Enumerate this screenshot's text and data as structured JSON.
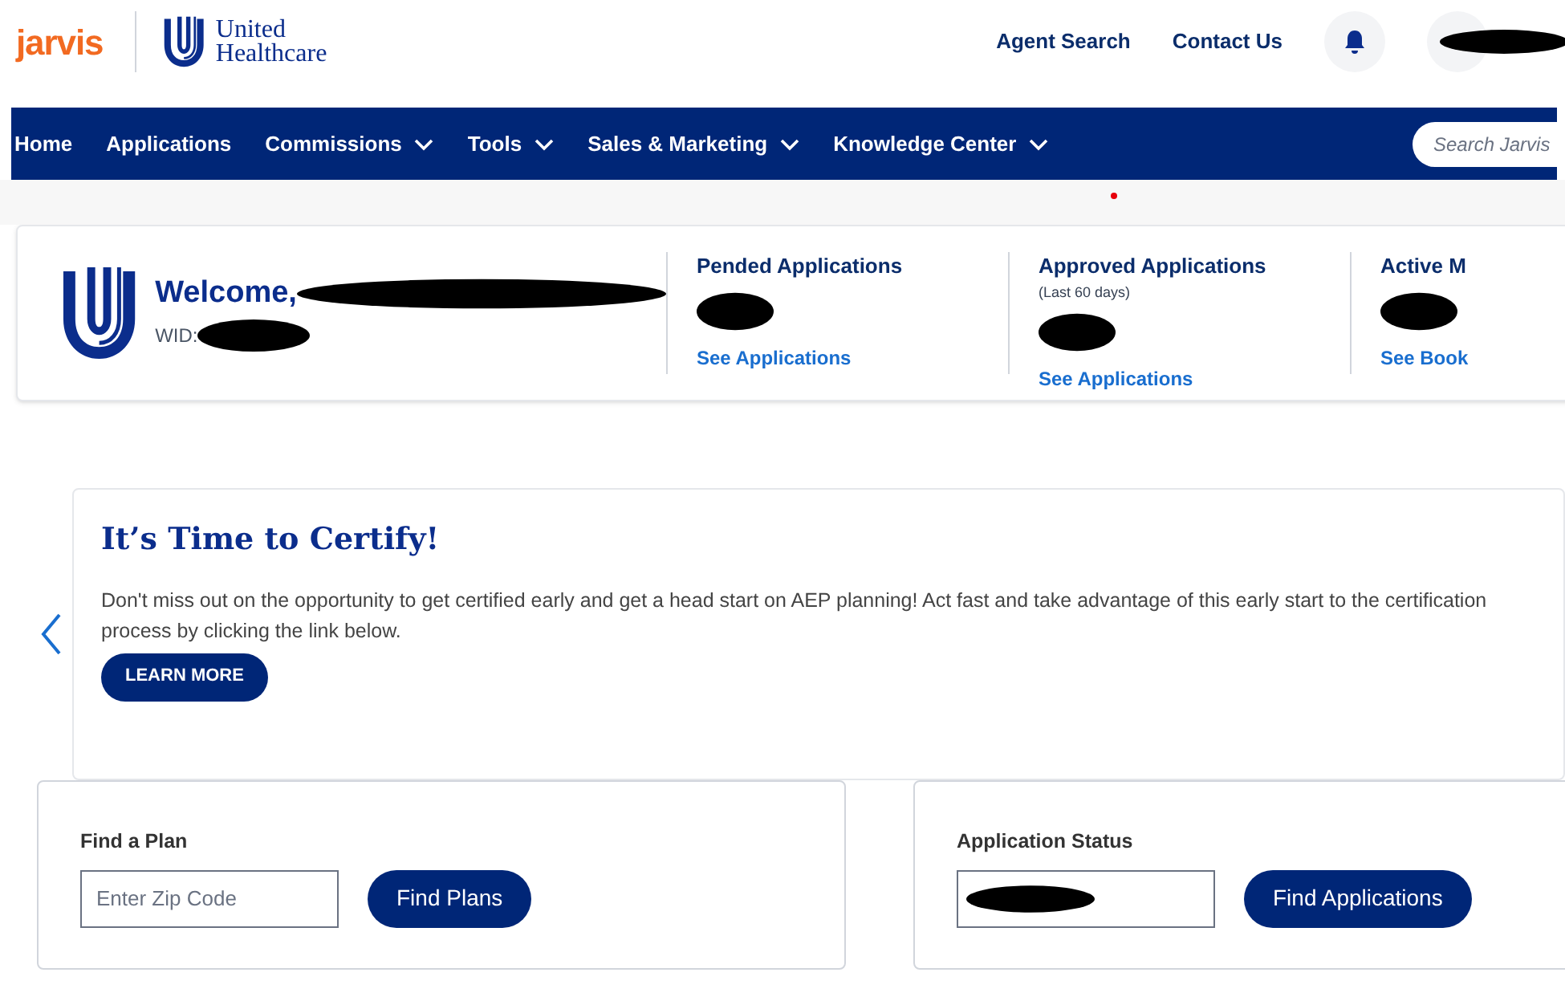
{
  "header": {
    "brand": "jarvis",
    "partner_line1": "United",
    "partner_line2": "Healthcare",
    "links": [
      "Agent Search",
      "Contact Us"
    ]
  },
  "nav": {
    "items": [
      {
        "label": "Home",
        "dropdown": false
      },
      {
        "label": "Applications",
        "dropdown": false
      },
      {
        "label": "Commissions",
        "dropdown": true
      },
      {
        "label": "Tools",
        "dropdown": true
      },
      {
        "label": "Sales & Marketing",
        "dropdown": true
      },
      {
        "label": "Knowledge Center",
        "dropdown": true
      }
    ],
    "search": {
      "placeholder": "Search Jarvis"
    }
  },
  "summary": {
    "welcome": "Welcome,",
    "wid_label": "WID:",
    "stats": [
      {
        "title": "Pended Applications",
        "link": "See Applications"
      },
      {
        "title": "Approved Applications",
        "note": "(Last 60 days)",
        "link": "See Applications"
      },
      {
        "title": "Active M",
        "link": "See Book"
      }
    ]
  },
  "banner": {
    "title": "It’s Time to Certify!",
    "text": "Don't miss out on the opportunity to get certified early and get a head start on AEP planning! Act fast and take advantage of this early start to the certification process by clicking the link below.",
    "button": "LEARN MORE"
  },
  "cards": [
    {
      "title": "Find a Plan",
      "placeholder": "Enter Zip Code",
      "button": "Find Plans",
      "redacted": false
    },
    {
      "title": "Application Status",
      "button": "Find Applications",
      "redacted": true
    }
  ]
}
